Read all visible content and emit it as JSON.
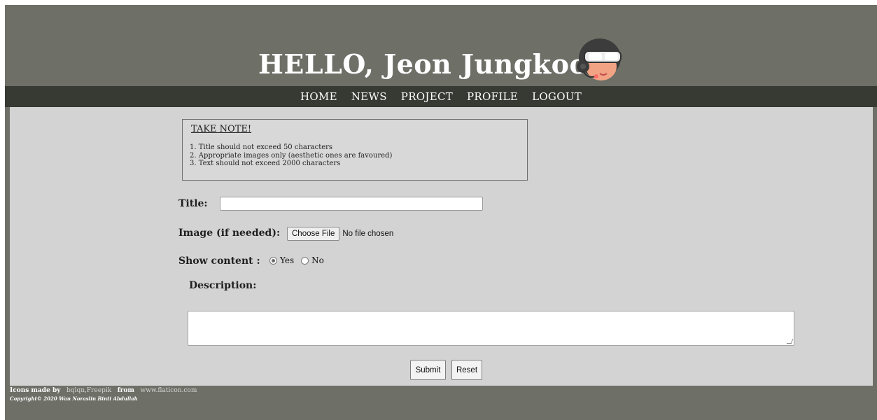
{
  "header": {
    "title": "HELLO, Jeon Jungkook",
    "avatar_icon": "pilot-avatar-icon"
  },
  "nav": {
    "items": [
      "HOME",
      "NEWS",
      "PROJECT",
      "PROFILE",
      "LOGOUT"
    ]
  },
  "note": {
    "title": "TAKE NOTE!",
    "items": [
      "1. Title should not exceed 50 characters",
      "2. Appropriate images only (aesthetic ones are favoured)",
      "3. Text should not exceed 2000 characters"
    ]
  },
  "form": {
    "title_label": "Title:",
    "title_value": "",
    "image_label": "Image (if needed):",
    "file_button": "Choose File",
    "file_status": "No file chosen",
    "show_content_label": "Show content :",
    "options": [
      "Yes",
      "No"
    ],
    "selected_option": "Yes",
    "description_label": "Description:",
    "description_value": "",
    "submit_label": "Submit",
    "reset_label": "Reset"
  },
  "footer": {
    "icons_made_by": "Icons made by",
    "authors": "bqlqn,Freepik",
    "from": "from",
    "site": "www.flaticon.com",
    "copyright": "Copyright© 2020 Wan Noraslin Binti Abdullah"
  },
  "colors": {
    "frame": "#6e7068",
    "nav_bar": "#363a33",
    "content_bg": "#d3d3d3"
  }
}
